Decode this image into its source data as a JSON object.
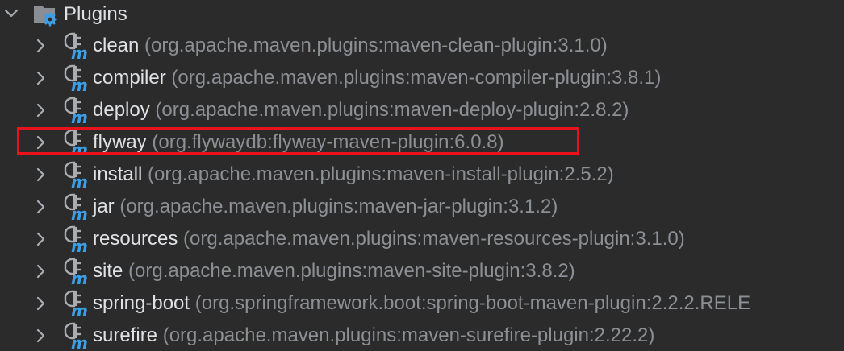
{
  "group": {
    "label": "Plugins",
    "expanded": true,
    "icon": "plugins-folder-icon"
  },
  "plugins": [
    {
      "name": "clean",
      "coordinates": "(org.apache.maven.plugins:maven-clean-plugin:3.1.0)"
    },
    {
      "name": "compiler",
      "coordinates": "(org.apache.maven.plugins:maven-compiler-plugin:3.8.1)"
    },
    {
      "name": "deploy",
      "coordinates": "(org.apache.maven.plugins:maven-deploy-plugin:2.8.2)"
    },
    {
      "name": "flyway",
      "coordinates": "(org.flywaydb:flyway-maven-plugin:6.0.8)",
      "highlighted": true
    },
    {
      "name": "install",
      "coordinates": "(org.apache.maven.plugins:maven-install-plugin:2.5.2)"
    },
    {
      "name": "jar",
      "coordinates": "(org.apache.maven.plugins:maven-jar-plugin:3.1.2)"
    },
    {
      "name": "resources",
      "coordinates": "(org.apache.maven.plugins:maven-resources-plugin:3.1.0)"
    },
    {
      "name": "site",
      "coordinates": "(org.apache.maven.plugins:maven-site-plugin:3.8.2)"
    },
    {
      "name": "spring-boot",
      "coordinates": "(org.springframework.boot:spring-boot-maven-plugin:2.2.2.RELE"
    },
    {
      "name": "surefire",
      "coordinates": "(org.apache.maven.plugins:maven-surefire-plugin:2.22.2)"
    }
  ],
  "colors": {
    "background": "#2b2b2b",
    "name_text": "#dfe1e5",
    "coordinate_text": "#8c8f93",
    "highlight_border": "#e8131b",
    "icon_accent": "#3d9ee3"
  }
}
